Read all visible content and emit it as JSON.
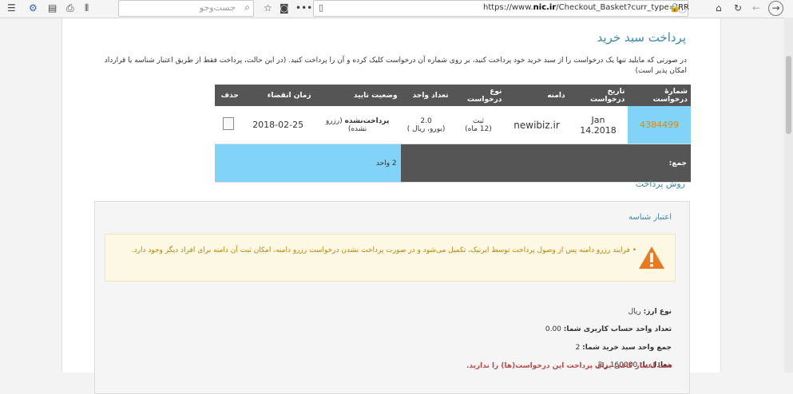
{
  "browser": {
    "search_placeholder": "جست‌وجو",
    "url_prefix": "https://www.",
    "url_domain": "nic.ir",
    "url_path": "/Checkout_Basket?curr_type=IRR"
  },
  "page": {
    "title": "پرداخت سبد خرید",
    "intro": "در صورتی که مایلید تنها یک درخواست را از سبد خرید خود پرداخت کنید، بر روی شماره آن درخواست کلیک کرده و آن را پرداخت کنید. (در این حالت، پرداخت فقط از طریق اعتبار شناسه یا قرارداد امکان پذیر است)"
  },
  "table": {
    "headers": [
      "شمارهٔ درخواست",
      "تاریخ درخواست",
      "دامنه",
      "نوع درخواست",
      "تعداد واحد",
      "وضعیت تایید",
      "زمان انقضاء",
      "حذف"
    ],
    "row": {
      "id": "4384499",
      "date": "Jan 14.2018",
      "domain": "newibiz.ir",
      "type": "ثبت",
      "type_period": "(12 ماه)",
      "units": "2.0",
      "units_note": "(یورو، ریال )",
      "status": "پرداخت‌نشده",
      "status_note": "(رزرو نشده)",
      "expiry": "2018-02-25"
    },
    "total_label": "جمع:",
    "total_value": "2 واحد"
  },
  "payment": {
    "title": "روش پرداخت",
    "panel_title": "اعتبار شناسه",
    "warning": "فرایند رزرو دامنه پس از وصول پرداخت توسط ایرنیک، تکمیل می‌شود و در صورت پرداخت نشدن درخواست رزرو دامنه، امکان ثبت آن دامنه برای افراد دیگر وجود دارد.",
    "currency_label": "نوع ارز:",
    "currency_value": "ریال",
    "balance_label": "تعداد واحد حساب کاربری شما:",
    "balance_value": "0.00",
    "basket_label": "جمع واحد سبد خرید شما:",
    "basket_value": "2",
    "equiv_label": "معادل با:",
    "equiv_value": "160000 ریال",
    "error": "شما اعتبار کافی برای پرداخت این درخواست(ها) را ندارید."
  },
  "colors": {
    "accent": "#3a87ad",
    "header_bg": "#555555",
    "highlight": "#81d4f7",
    "warning_bg": "#fcf8e3",
    "error": "#b94a48"
  }
}
